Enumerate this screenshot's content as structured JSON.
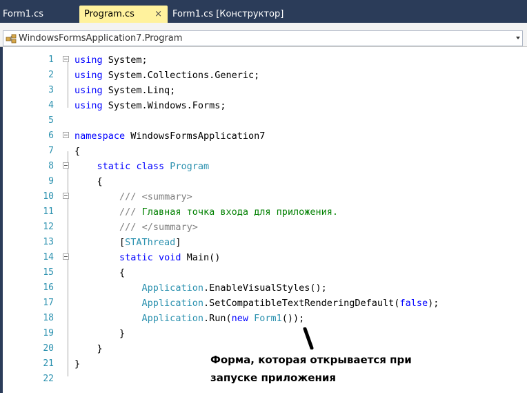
{
  "tabs": [
    {
      "label": "Form1.cs",
      "active": false
    },
    {
      "label": "Program.cs",
      "active": true
    },
    {
      "label": "Form1.cs [Конструктор]",
      "active": false
    }
  ],
  "tab_close_glyph": "×",
  "navigation": {
    "selected": "WindowsFormsApplication7.Program",
    "icon": "class-icon"
  },
  "editor": {
    "line_numbers": [
      "1",
      "2",
      "3",
      "4",
      "5",
      "6",
      "7",
      "8",
      "9",
      "10",
      "11",
      "12",
      "13",
      "14",
      "15",
      "16",
      "17",
      "18",
      "19",
      "20",
      "21",
      "22"
    ],
    "lines": [
      [
        [
          "kw",
          "using"
        ],
        [
          "",
          "System;"
        ]
      ],
      [
        [
          "kw",
          "using"
        ],
        [
          "",
          "System.Collections.Generic;"
        ]
      ],
      [
        [
          "kw",
          "using"
        ],
        [
          "",
          "System.Linq;"
        ]
      ],
      [
        [
          "kw",
          "using"
        ],
        [
          "",
          "System.Windows.Forms;"
        ]
      ],
      [],
      [
        [
          "kw",
          "namespace"
        ],
        [
          "",
          "WindowsFormsApplication7"
        ]
      ],
      [
        [
          "",
          "{"
        ]
      ],
      [
        [
          "",
          "    "
        ],
        [
          "kw",
          "static"
        ],
        [
          "",
          ""
        ],
        [
          "kw",
          "class"
        ],
        [
          "",
          ""
        ],
        [
          "ty",
          "Program"
        ]
      ],
      [
        [
          "",
          "    {"
        ]
      ],
      [
        [
          "",
          "        "
        ],
        [
          "cg",
          "///"
        ],
        [
          "",
          ""
        ],
        [
          "cg",
          "<summary>"
        ]
      ],
      [
        [
          "",
          "        "
        ],
        [
          "cg",
          "///"
        ],
        [
          "",
          ""
        ],
        [
          "cm",
          "Главная точка входа для приложения."
        ]
      ],
      [
        [
          "",
          "        "
        ],
        [
          "cg",
          "///"
        ],
        [
          "",
          ""
        ],
        [
          "cg",
          "</summary>"
        ]
      ],
      [
        [
          "",
          "        ["
        ],
        [
          "ty",
          "STAThread"
        ],
        [
          "",
          "]"
        ]
      ],
      [
        [
          "",
          "        "
        ],
        [
          "kw",
          "static"
        ],
        [
          "",
          ""
        ],
        [
          "kw",
          "void"
        ],
        [
          "",
          "Main()"
        ]
      ],
      [
        [
          "",
          "        {"
        ]
      ],
      [
        [
          "",
          "            "
        ],
        [
          "ty",
          "Application"
        ],
        [
          "",
          ".EnableVisualStyles();"
        ]
      ],
      [
        [
          "",
          "            "
        ],
        [
          "ty",
          "Application"
        ],
        [
          "",
          ".SetCompatibleTextRenderingDefault("
        ],
        [
          "kw",
          "false"
        ],
        [
          "",
          ");"
        ]
      ],
      [
        [
          "",
          "            "
        ],
        [
          "ty",
          "Application"
        ],
        [
          "",
          ".Run("
        ],
        [
          "kw",
          "new"
        ],
        [
          "",
          ""
        ],
        [
          "ty",
          "Form1"
        ],
        [
          "",
          "());"
        ]
      ],
      [
        [
          "",
          "        }"
        ]
      ],
      [
        [
          "",
          "    }"
        ]
      ],
      [
        [
          "",
          "}"
        ]
      ],
      []
    ]
  },
  "annotation": {
    "line1": "Форма, которая открывается при",
    "line2": "запуске приложения"
  },
  "colors": {
    "keyword": "#0000ff",
    "type": "#2b91af",
    "comment": "#008000",
    "doc_tag": "#808080",
    "tab_strip": "#2b3c59",
    "active_tab": "#fff29d"
  }
}
